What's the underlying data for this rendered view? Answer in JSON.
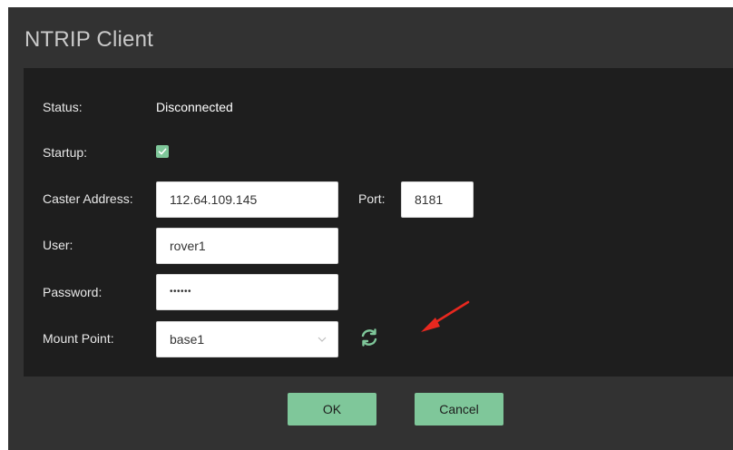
{
  "dialog": {
    "title": "NTRIP Client"
  },
  "form": {
    "status_label": "Status:",
    "status_value": "Disconnected",
    "startup_label": "Startup:",
    "startup_checked": true,
    "caster_label": "Caster Address:",
    "caster_value": "112.64.109.145",
    "port_label": "Port:",
    "port_value": "8181",
    "user_label": "User:",
    "user_value": "rover1",
    "password_label": "Password:",
    "password_value": "••••••",
    "mount_label": "Mount Point:",
    "mount_value": "base1"
  },
  "icons": {
    "checkbox": "check-icon",
    "dropdown": "chevron-down-icon",
    "refresh": "refresh-icon",
    "annotation": "red-arrow-icon"
  },
  "buttons": {
    "ok_label": "OK",
    "cancel_label": "Cancel"
  },
  "colors": {
    "accent": "#7fc79a",
    "dialog_bg": "#323232",
    "panel_bg": "#1e1e1e",
    "arrow": "#e8281f"
  }
}
